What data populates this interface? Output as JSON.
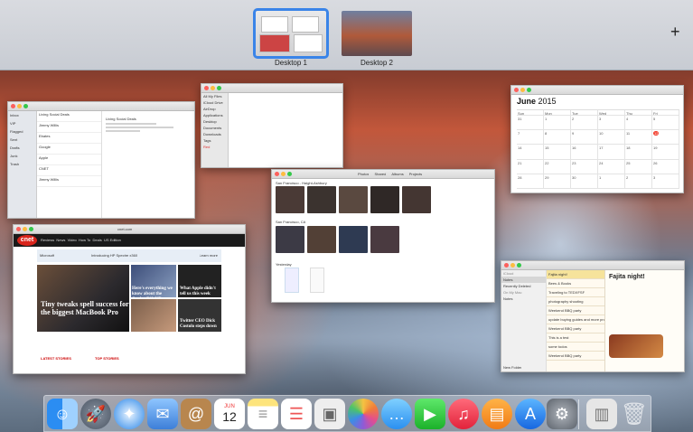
{
  "spaces": {
    "desktops": [
      {
        "label": "Desktop 1",
        "selected": true
      },
      {
        "label": "Desktop 2",
        "selected": false
      }
    ],
    "add_label": "+"
  },
  "mail": {
    "inbox": "Inbox",
    "items": [
      "Living Social Deals",
      "Jimmy Willis",
      "Ebates",
      "Google",
      "Apple",
      "CNET",
      "Jimmy Willis"
    ],
    "side": [
      "Inbox",
      "VIP",
      "Flagged",
      "Sent",
      "Drafts",
      "Junk",
      "Trash"
    ]
  },
  "finder": {
    "side": [
      "All My Files",
      "iCloud Drive",
      "AirDrop",
      "Applications",
      "Desktop",
      "Documents",
      "Downloads",
      "Tags",
      "Red"
    ]
  },
  "calendar": {
    "month": "June",
    "year": "2015",
    "days": [
      "Sun",
      "Mon",
      "Tue",
      "Wed",
      "Thu",
      "Fri"
    ],
    "today": "12",
    "dates": [
      "31",
      "1",
      "2",
      "3",
      "4",
      "5",
      "7",
      "8",
      "9",
      "10",
      "11",
      "12",
      "14",
      "15",
      "16",
      "17",
      "18",
      "19",
      "21",
      "22",
      "23",
      "24",
      "25",
      "26",
      "28",
      "29",
      "30",
      "1",
      "2",
      "3"
    ]
  },
  "photos": {
    "tabs": [
      "Photos",
      "Shared",
      "Albums",
      "Projects"
    ],
    "section1": "San Francisco - Haight-Ashbury",
    "section2": "San Francisco, CA",
    "section3": "Yesterday"
  },
  "safari": {
    "url": "cnet.com",
    "logo": "cnet",
    "nav": [
      "Reviews",
      "News",
      "Video",
      "How To",
      "Deals",
      "US Edition"
    ],
    "ad_brand": "Microsoft",
    "ad_text": "Introducing HP Spectre x360",
    "ad_button": "Learn more",
    "headline": "Tiny tweaks spell success for the biggest MacBook Pro",
    "side1": "Here's everything we know about the Oculus Rift VR headset",
    "side2": "What Apple didn't tell us this week",
    "side3": "Twitter CEO Dick Costolo steps down",
    "latest": "LATEST STORIES",
    "top": "TOP STORIES"
  },
  "notes": {
    "title": "Fajita night!",
    "items": [
      "Fajita night!",
      "Bees & Books",
      "Traveling to TEDXFSF",
      "photography shooting",
      "Weekend BBQ party",
      "update buying guides and more products",
      "Weekend BBQ party",
      "This is a test",
      "some todos",
      "Weekend BBQ party"
    ],
    "side": [
      "iCloud",
      "Notes",
      "Recently Deleted",
      "On My Mac",
      "Notes"
    ],
    "new_folder": "New Folder"
  },
  "dock": {
    "calendar_month": "JUN",
    "calendar_day": "12",
    "icons": [
      "finder-icon",
      "launchpad-icon",
      "safari-icon",
      "mail-icon",
      "contacts-icon",
      "calendar-icon",
      "notes-icon",
      "reminders-icon",
      "preview-icon",
      "photos-icon",
      "messages-icon",
      "facetime-icon",
      "music-icon",
      "ibooks-icon",
      "app-store-icon",
      "system-preferences-icon",
      "documents-icon",
      "trash-icon"
    ]
  }
}
